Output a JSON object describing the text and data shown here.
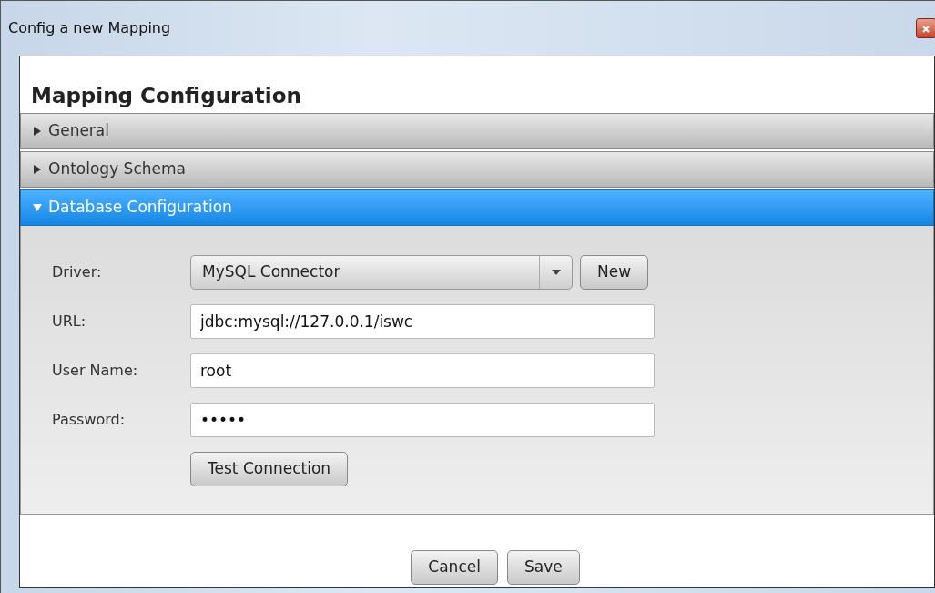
{
  "window": {
    "title": "Config a new Mapping"
  },
  "heading": "Mapping Configuration",
  "sections": [
    {
      "label": "General",
      "expanded": false
    },
    {
      "label": "Ontology Schema",
      "expanded": false
    },
    {
      "label": "Database Configuration",
      "expanded": true
    }
  ],
  "form": {
    "fields": [
      {
        "kind": "select",
        "label": "Driver:",
        "value": "MySQL Connector",
        "button": "New"
      },
      {
        "kind": "text",
        "label": "URL:",
        "value": "jdbc:mysql://127.0.0.1/iswc"
      },
      {
        "kind": "text",
        "label": "User Name:",
        "value": "root"
      },
      {
        "kind": "text",
        "label": "Password:",
        "value": "•••••"
      }
    ],
    "test_button": "Test Connection"
  },
  "buttons": [
    "Cancel",
    "Save"
  ]
}
